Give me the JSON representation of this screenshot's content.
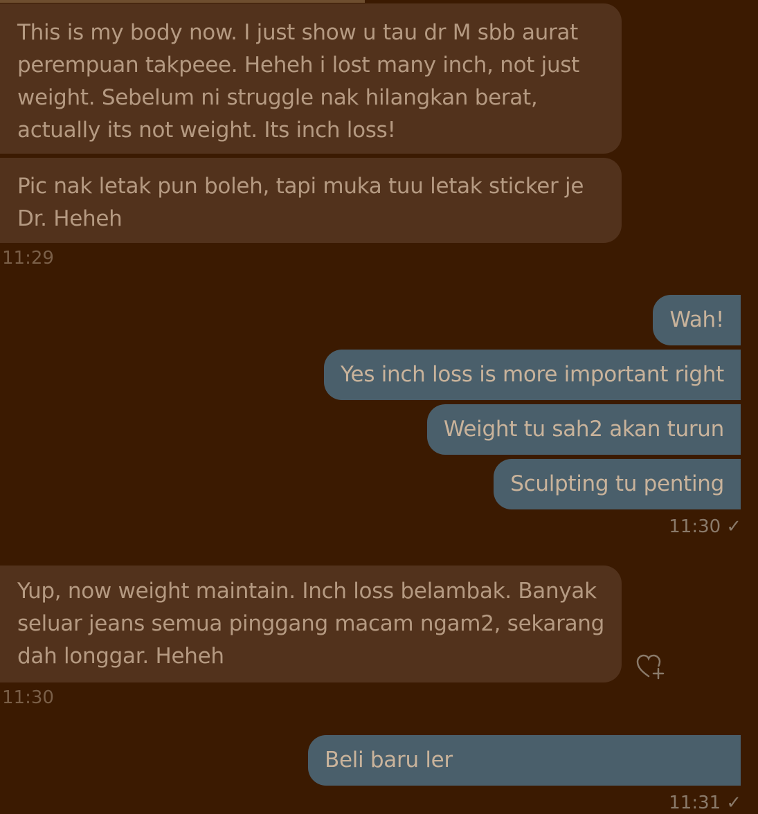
{
  "messages": [
    {
      "side": "in",
      "text": "This is my body now. I just show u tau dr M sbb aurat perempuan takpeee. Heheh i lost many inch, not just weight. Sebelum ni struggle nak hilangkan berat, actually its not weight. Its inch loss!"
    },
    {
      "side": "in",
      "text": "Pic nak letak pun boleh, tapi muka tuu letak sticker je Dr. Heheh"
    },
    {
      "side": "out",
      "text": "Wah!"
    },
    {
      "side": "out",
      "text": "Yes inch loss is more important right"
    },
    {
      "side": "out",
      "text": "Weight tu sah2 akan turun"
    },
    {
      "side": "out",
      "text": "Sculpting tu penting"
    },
    {
      "side": "in",
      "text": "Yup, now weight maintain. Inch loss belambak. Banyak seluar jeans semua pinggang macam ngam2, sekarang dah longgar. Heheh"
    },
    {
      "side": "out",
      "text": "Beli baru ler"
    }
  ],
  "timestamps": {
    "t1": "11:29",
    "t2": "11:30",
    "t3": "11:30",
    "t4": "11:31"
  },
  "status_icon": "✓",
  "icons": {
    "reaction": "heart-plus-icon"
  },
  "colors": {
    "background": "#3b1a01",
    "incoming_bubble": "#52321c",
    "outgoing_bubble": "#4a5f6b"
  }
}
